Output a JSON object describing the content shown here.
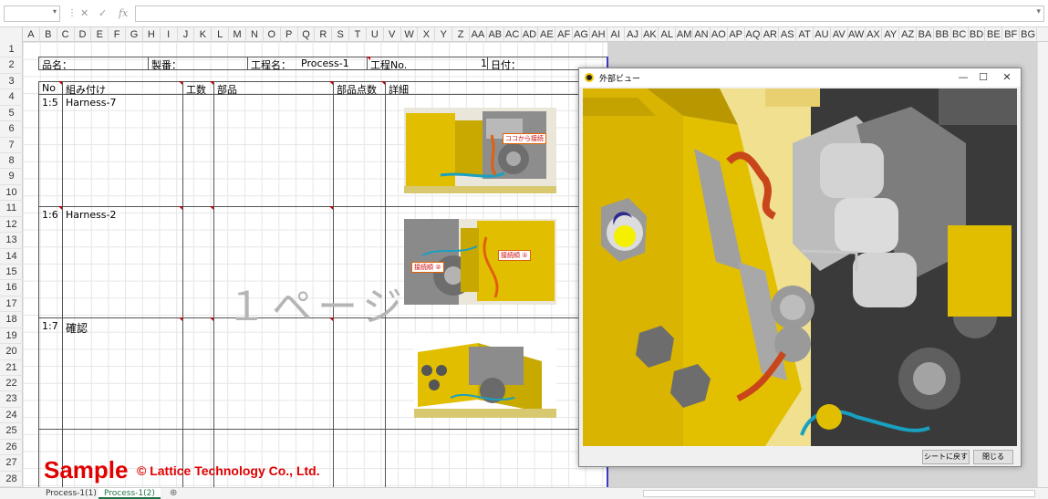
{
  "formula_bar": {
    "name_box": "",
    "cancel_icon": "✕",
    "enter_icon": "✓",
    "fx_label": "fx",
    "formula": ""
  },
  "columns": [
    "A",
    "B",
    "C",
    "D",
    "E",
    "F",
    "G",
    "H",
    "I",
    "J",
    "K",
    "L",
    "M",
    "N",
    "O",
    "P",
    "Q",
    "R",
    "S",
    "T",
    "U",
    "V",
    "W",
    "X",
    "Y",
    "Z",
    "AA",
    "AB",
    "AC",
    "AD",
    "AE",
    "AF",
    "AG",
    "AH",
    "AI",
    "AJ",
    "AK",
    "AL",
    "AM",
    "AN",
    "AO",
    "AP",
    "AQ",
    "AR",
    "AS",
    "AT",
    "AU",
    "AV",
    "AW",
    "AX",
    "AY",
    "AZ",
    "BA",
    "BB",
    "BC",
    "BD",
    "BE",
    "BF",
    "BG"
  ],
  "rows": [
    "1",
    "2",
    "3",
    "4",
    "5",
    "6",
    "7",
    "8",
    "9",
    "10",
    "11",
    "12",
    "13",
    "14",
    "15",
    "16",
    "17",
    "18",
    "19",
    "20",
    "21",
    "22",
    "23",
    "24",
    "25",
    "26",
    "27",
    "28"
  ],
  "form": {
    "hinmei_label": "品名：",
    "seiban_label": "製番：",
    "koutei_label": "工程名：",
    "koutei_value": "Process-1",
    "kouteino_label": "工程No.",
    "kouteino_value": "1",
    "hiduke_label": "日付：",
    "headers": {
      "no": "No",
      "assembly": "組み付け",
      "kousu": "工数",
      "parts": "部品",
      "parts_count": "部品点数",
      "detail": "詳細"
    },
    "steps": [
      {
        "no": "1:5",
        "name": "Harness-7"
      },
      {
        "no": "1:6",
        "name": "Harness-2"
      },
      {
        "no": "1:7",
        "name": "確認"
      }
    ],
    "callouts": [
      "ココから接続",
      "接続順 ①",
      "接続順 ②"
    ]
  },
  "watermark_page": "１ページ",
  "sample_text": "Sample",
  "copyright_text": "© Lattice Technology Co., Ltd.",
  "sheet_tabs": [
    "Process-1(1)",
    "Process-1(2)"
  ],
  "active_tab": 1,
  "add_tab_icon": "⊕",
  "viewer": {
    "title": "外部ビュー",
    "minimize": "—",
    "maximize": "☐",
    "close": "✕",
    "return_button": "シートに戻す",
    "close_button": "閉じる"
  },
  "colors": {
    "sample_red": "#e00000",
    "machine_yellow": "#e1bf00",
    "page_border_blue": "#3b3bc4",
    "active_tab_green": "#217346"
  }
}
